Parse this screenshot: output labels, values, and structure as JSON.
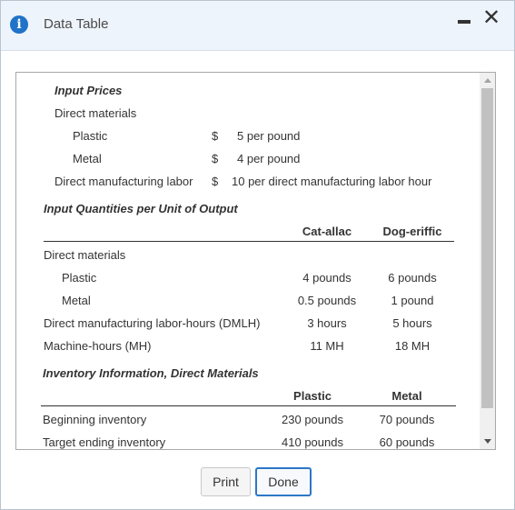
{
  "window": {
    "title": "Data Table"
  },
  "input_prices": {
    "heading": "Input Prices",
    "direct_materials": "Direct materials",
    "plastic": {
      "label": "Plastic",
      "currency": "$",
      "value": "5 per pound"
    },
    "metal": {
      "label": "Metal",
      "currency": "$",
      "value": "4 per pound"
    },
    "labor": {
      "label": "Direct manufacturing labor",
      "currency": "$",
      "value": "10 per direct manufacturing labor hour"
    }
  },
  "input_quantities": {
    "heading": "Input Quantities per Unit of Output",
    "columns": [
      "Cat-allac",
      "Dog-eriffic"
    ],
    "direct_materials": "Direct materials",
    "rows": [
      {
        "label": "Plastic",
        "values": [
          "4 pounds",
          "6 pounds"
        ]
      },
      {
        "label": "Metal",
        "values": [
          "0.5 pounds",
          "1 pound"
        ]
      },
      {
        "label": "Direct manufacturing labor-hours (DMLH)",
        "values": [
          "3 hours",
          "5 hours"
        ]
      },
      {
        "label": "Machine-hours (MH)",
        "values": [
          "11 MH",
          "18 MH"
        ]
      }
    ]
  },
  "inventory": {
    "heading": "Inventory Information, Direct Materials",
    "columns": [
      "Plastic",
      "Metal"
    ],
    "rows": [
      {
        "label": "Beginning inventory",
        "values": [
          "230 pounds",
          "70 pounds"
        ]
      },
      {
        "label": "Target ending inventory",
        "values": [
          "410 pounds",
          "60 pounds"
        ]
      }
    ]
  },
  "buttons": {
    "print": "Print",
    "done": "Done"
  }
}
